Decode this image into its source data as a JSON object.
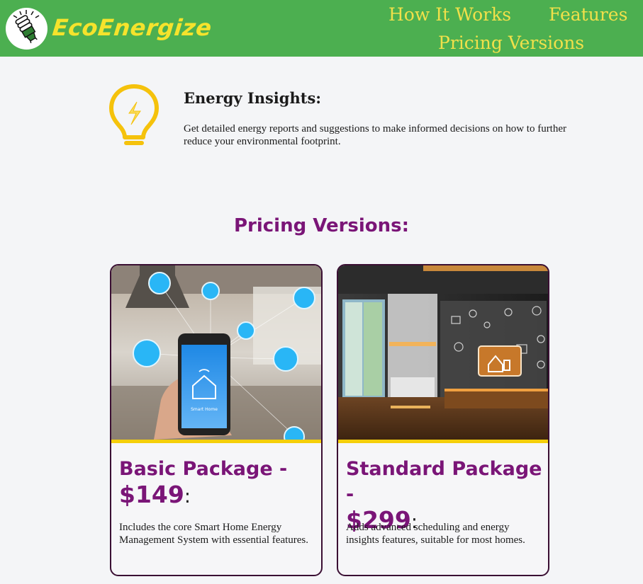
{
  "header": {
    "logo_text": "EcoEnergize",
    "nav": {
      "how_it_works": "How It Works",
      "features": "Features",
      "pricing_versions": "Pricing Versions"
    },
    "colors": {
      "background": "#4caf50",
      "nav_text": "#f0e04a",
      "logo_text": "#f5e32c"
    }
  },
  "insight": {
    "icon": "lightbulb-icon",
    "title": "Energy Insights:",
    "text": "Get detailed energy reports and suggestions to make informed decisions on how to further reduce your environmental footprint."
  },
  "pricing": {
    "heading": "Pricing Versions:",
    "accent_color": "#7a1577",
    "cards": [
      {
        "name": "Basic Package -",
        "price": "$149",
        "colon": ":",
        "description": "Includes the core Smart Home Energy Management System with essential features.",
        "image_label": "Smart Home"
      },
      {
        "name": "Standard Package -",
        "price": "$299",
        "colon": ":",
        "description": "Adds advanced scheduling and energy insights features, suitable for most homes."
      }
    ]
  }
}
